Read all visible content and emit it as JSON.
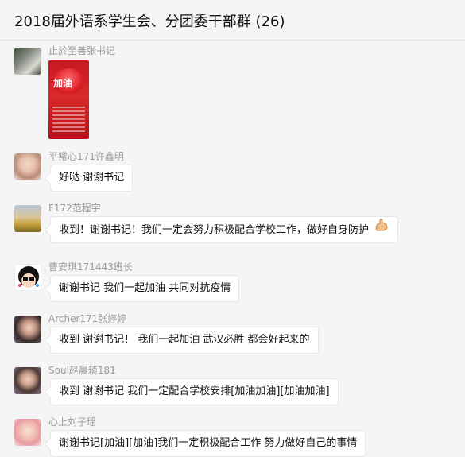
{
  "chat": {
    "title": "2018届外语系学生会、分团委干部群 (26)",
    "messages": [
      {
        "sender": "止於至善张书记",
        "type": "image",
        "image_alt": "加油 poster"
      },
      {
        "sender": "平常心171许鑫明",
        "text": "好哒 谢谢书记"
      },
      {
        "sender": "F172范程宇",
        "text": "收到！谢谢书记！我们一定会努力积极配合学校工作，做好自身防护",
        "emoji": "flexed-biceps"
      },
      {
        "sender": "曹安琪171443班长",
        "text": "谢谢书记  我们一起加油 共同对抗疫情"
      },
      {
        "sender": "Archer171张婷婷",
        "text": "收到 谢谢书记！ 我们一起加油  武汉必胜  都会好起来的"
      },
      {
        "sender": "Soul赵晨琦181",
        "text": "收到 谢谢书记 我们一定配合学校安排[加油加油][加油加油]"
      },
      {
        "sender": "心上刘子瑶",
        "text": "谢谢书记[加油][加油]我们一定积极配合工作 努力做好自己的事情"
      }
    ]
  },
  "colors": {
    "background": "#f5f5f5",
    "bubble": "#ffffff",
    "sender_name": "#9a9a9a",
    "poster_red": "#c51820"
  }
}
